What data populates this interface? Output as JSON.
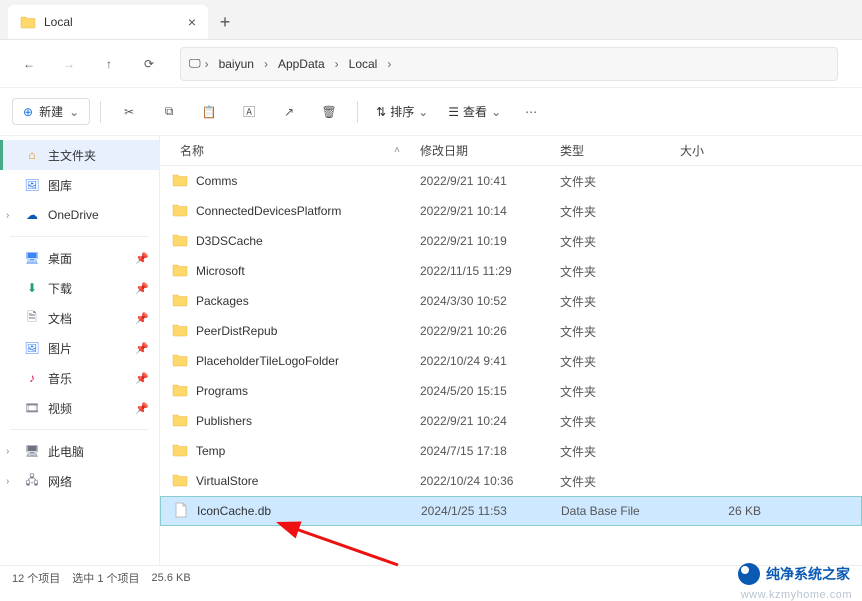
{
  "tab": {
    "title": "Local"
  },
  "breadcrumb": [
    "baiyun",
    "AppData",
    "Local"
  ],
  "toolbar": {
    "new_label": "新建",
    "sort_label": "排序",
    "view_label": "查看"
  },
  "sidebar": {
    "home": "主文件夹",
    "gallery": "图库",
    "onedrive": "OneDrive",
    "desktop": "桌面",
    "downloads": "下载",
    "documents": "文档",
    "pictures": "图片",
    "music": "音乐",
    "videos": "视频",
    "thispc": "此电脑",
    "network": "网络"
  },
  "columns": {
    "name": "名称",
    "date": "修改日期",
    "type": "类型",
    "size": "大小"
  },
  "folder_type": "文件夹",
  "files": [
    {
      "name": "Comms",
      "date": "2022/9/21 10:41",
      "type": "文件夹",
      "size": ""
    },
    {
      "name": "ConnectedDevicesPlatform",
      "date": "2022/9/21 10:14",
      "type": "文件夹",
      "size": ""
    },
    {
      "name": "D3DSCache",
      "date": "2022/9/21 10:19",
      "type": "文件夹",
      "size": ""
    },
    {
      "name": "Microsoft",
      "date": "2022/11/15 11:29",
      "type": "文件夹",
      "size": ""
    },
    {
      "name": "Packages",
      "date": "2024/3/30 10:52",
      "type": "文件夹",
      "size": ""
    },
    {
      "name": "PeerDistRepub",
      "date": "2022/9/21 10:26",
      "type": "文件夹",
      "size": ""
    },
    {
      "name": "PlaceholderTileLogoFolder",
      "date": "2022/10/24 9:41",
      "type": "文件夹",
      "size": ""
    },
    {
      "name": "Programs",
      "date": "2024/5/20 15:15",
      "type": "文件夹",
      "size": ""
    },
    {
      "name": "Publishers",
      "date": "2022/9/21 10:24",
      "type": "文件夹",
      "size": ""
    },
    {
      "name": "Temp",
      "date": "2024/7/15 17:18",
      "type": "文件夹",
      "size": ""
    },
    {
      "name": "VirtualStore",
      "date": "2022/10/24 10:36",
      "type": "文件夹",
      "size": ""
    },
    {
      "name": "IconCache.db",
      "date": "2024/1/25 11:53",
      "type": "Data Base File",
      "size": "26 KB",
      "is_file": true,
      "selected": true
    }
  ],
  "status": {
    "count": "12 个项目",
    "selected": "选中 1 个项目",
    "size": "25.6 KB"
  },
  "watermark": {
    "text": "纯净系统之家",
    "url": "www.kzmyhome.com"
  }
}
